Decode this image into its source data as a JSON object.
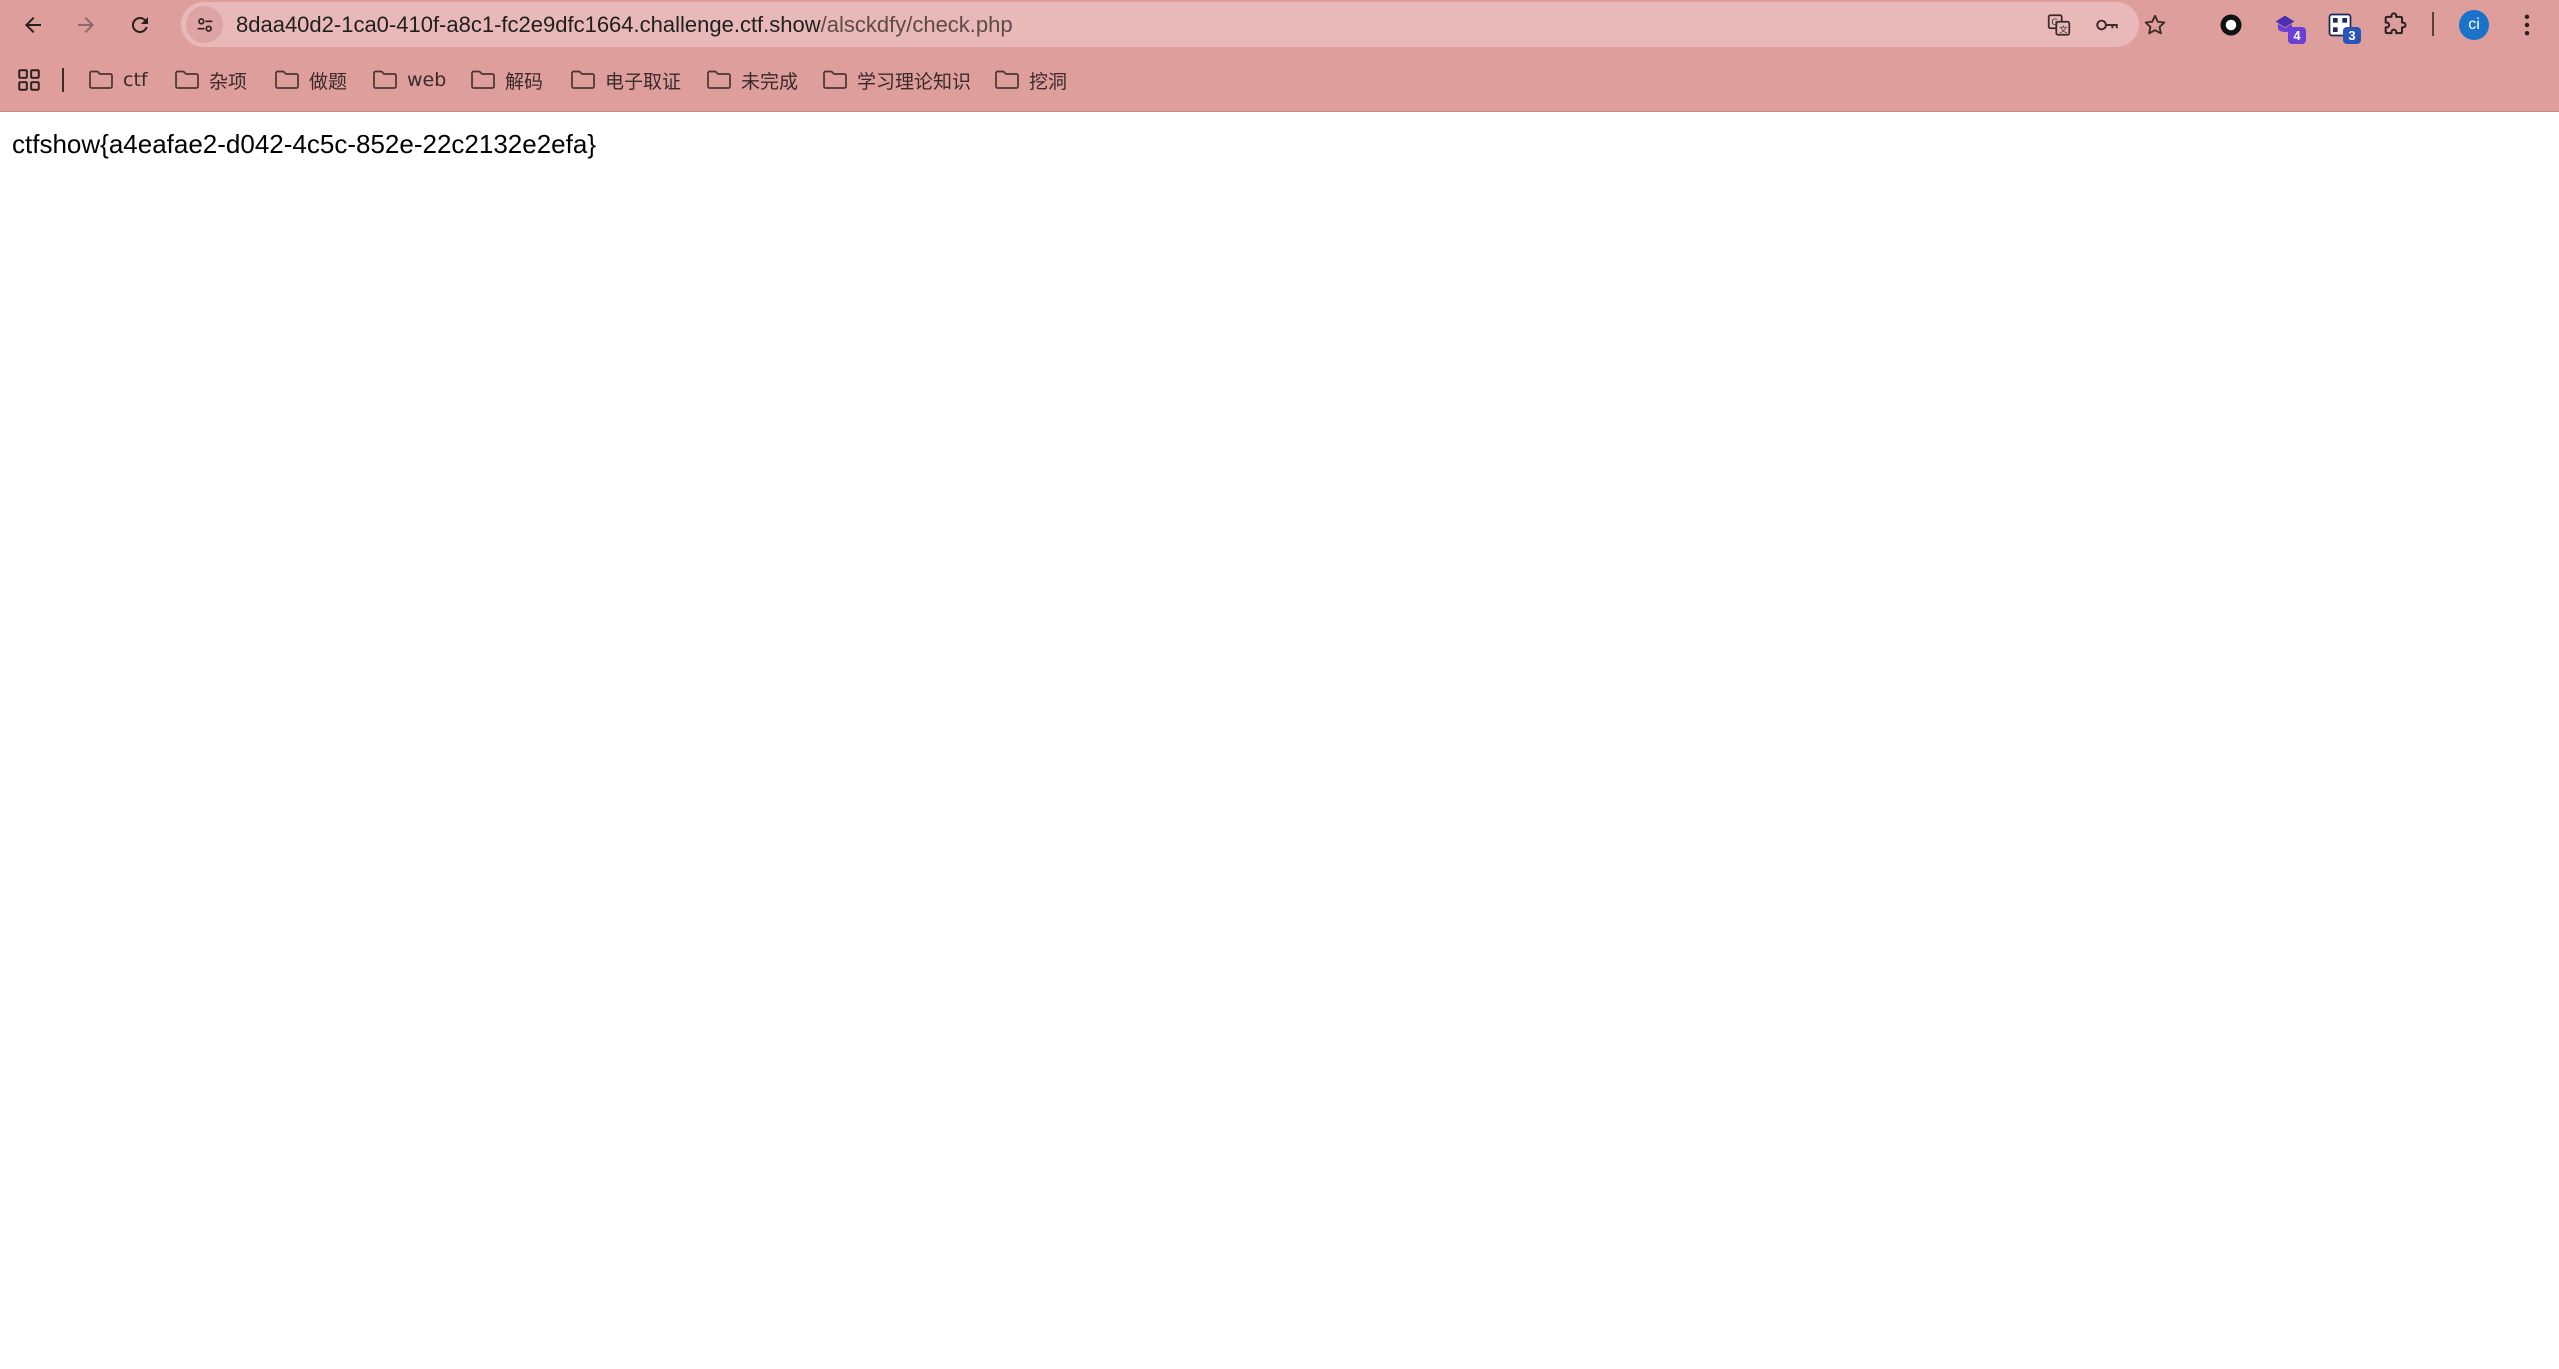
{
  "address_bar": {
    "host": "8daa40d2-1ca0-410f-a8c1-fc2e9dfc1664.challenge.ctf.show",
    "path": "/alsckdfy/check.php"
  },
  "extensions": [
    {
      "icon": "circle-extension-icon",
      "badge": ""
    },
    {
      "icon": "shield-extension-icon",
      "badge": "4",
      "badge_color": "#6a3fd8"
    },
    {
      "icon": "qr-extension-icon",
      "badge": "3",
      "badge_color": "#2a55b8"
    }
  ],
  "profile": {
    "initials": "ci",
    "color": "#1a73c9"
  },
  "bookmarks": [
    {
      "label": "ctf"
    },
    {
      "label": "杂项"
    },
    {
      "label": "做题"
    },
    {
      "label": "web"
    },
    {
      "label": "解码"
    },
    {
      "label": "电子取证"
    },
    {
      "label": "未完成"
    },
    {
      "label": "学习理论知识"
    },
    {
      "label": "挖洞"
    }
  ],
  "page": {
    "content": "ctfshow{a4eafae2-d042-4c5c-852e-22c2132e2efa}"
  }
}
